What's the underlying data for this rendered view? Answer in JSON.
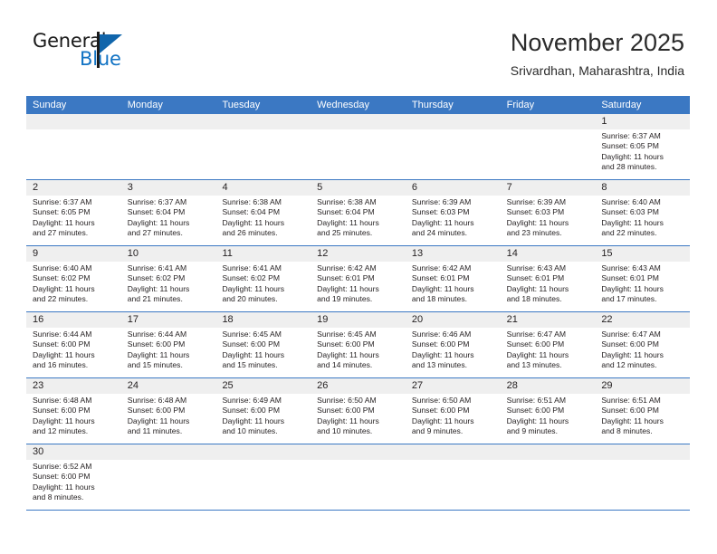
{
  "brand": {
    "name_top": "General",
    "name_bottom": "Blue",
    "accent_color": "#1273c4",
    "mark_color": "#1065ab"
  },
  "header": {
    "title": "November 2025",
    "subtitle": "Srivardhan, Maharashtra, India"
  },
  "calendar": {
    "header_color": "#3b78c3",
    "daynum_band_color": "#efefef",
    "weekdays": [
      "Sunday",
      "Monday",
      "Tuesday",
      "Wednesday",
      "Thursday",
      "Friday",
      "Saturday"
    ],
    "weeks": [
      [
        {
          "day": "",
          "empty": true
        },
        {
          "day": "",
          "empty": true
        },
        {
          "day": "",
          "empty": true
        },
        {
          "day": "",
          "empty": true
        },
        {
          "day": "",
          "empty": true
        },
        {
          "day": "",
          "empty": true
        },
        {
          "day": "1",
          "sunrise": "Sunrise: 6:37 AM",
          "sunset": "Sunset: 6:05 PM",
          "daylight_1": "Daylight: 11 hours",
          "daylight_2": "and 28 minutes."
        }
      ],
      [
        {
          "day": "2",
          "sunrise": "Sunrise: 6:37 AM",
          "sunset": "Sunset: 6:05 PM",
          "daylight_1": "Daylight: 11 hours",
          "daylight_2": "and 27 minutes."
        },
        {
          "day": "3",
          "sunrise": "Sunrise: 6:37 AM",
          "sunset": "Sunset: 6:04 PM",
          "daylight_1": "Daylight: 11 hours",
          "daylight_2": "and 27 minutes."
        },
        {
          "day": "4",
          "sunrise": "Sunrise: 6:38 AM",
          "sunset": "Sunset: 6:04 PM",
          "daylight_1": "Daylight: 11 hours",
          "daylight_2": "and 26 minutes."
        },
        {
          "day": "5",
          "sunrise": "Sunrise: 6:38 AM",
          "sunset": "Sunset: 6:04 PM",
          "daylight_1": "Daylight: 11 hours",
          "daylight_2": "and 25 minutes."
        },
        {
          "day": "6",
          "sunrise": "Sunrise: 6:39 AM",
          "sunset": "Sunset: 6:03 PM",
          "daylight_1": "Daylight: 11 hours",
          "daylight_2": "and 24 minutes."
        },
        {
          "day": "7",
          "sunrise": "Sunrise: 6:39 AM",
          "sunset": "Sunset: 6:03 PM",
          "daylight_1": "Daylight: 11 hours",
          "daylight_2": "and 23 minutes."
        },
        {
          "day": "8",
          "sunrise": "Sunrise: 6:40 AM",
          "sunset": "Sunset: 6:03 PM",
          "daylight_1": "Daylight: 11 hours",
          "daylight_2": "and 22 minutes."
        }
      ],
      [
        {
          "day": "9",
          "sunrise": "Sunrise: 6:40 AM",
          "sunset": "Sunset: 6:02 PM",
          "daylight_1": "Daylight: 11 hours",
          "daylight_2": "and 22 minutes."
        },
        {
          "day": "10",
          "sunrise": "Sunrise: 6:41 AM",
          "sunset": "Sunset: 6:02 PM",
          "daylight_1": "Daylight: 11 hours",
          "daylight_2": "and 21 minutes."
        },
        {
          "day": "11",
          "sunrise": "Sunrise: 6:41 AM",
          "sunset": "Sunset: 6:02 PM",
          "daylight_1": "Daylight: 11 hours",
          "daylight_2": "and 20 minutes."
        },
        {
          "day": "12",
          "sunrise": "Sunrise: 6:42 AM",
          "sunset": "Sunset: 6:01 PM",
          "daylight_1": "Daylight: 11 hours",
          "daylight_2": "and 19 minutes."
        },
        {
          "day": "13",
          "sunrise": "Sunrise: 6:42 AM",
          "sunset": "Sunset: 6:01 PM",
          "daylight_1": "Daylight: 11 hours",
          "daylight_2": "and 18 minutes."
        },
        {
          "day": "14",
          "sunrise": "Sunrise: 6:43 AM",
          "sunset": "Sunset: 6:01 PM",
          "daylight_1": "Daylight: 11 hours",
          "daylight_2": "and 18 minutes."
        },
        {
          "day": "15",
          "sunrise": "Sunrise: 6:43 AM",
          "sunset": "Sunset: 6:01 PM",
          "daylight_1": "Daylight: 11 hours",
          "daylight_2": "and 17 minutes."
        }
      ],
      [
        {
          "day": "16",
          "sunrise": "Sunrise: 6:44 AM",
          "sunset": "Sunset: 6:00 PM",
          "daylight_1": "Daylight: 11 hours",
          "daylight_2": "and 16 minutes."
        },
        {
          "day": "17",
          "sunrise": "Sunrise: 6:44 AM",
          "sunset": "Sunset: 6:00 PM",
          "daylight_1": "Daylight: 11 hours",
          "daylight_2": "and 15 minutes."
        },
        {
          "day": "18",
          "sunrise": "Sunrise: 6:45 AM",
          "sunset": "Sunset: 6:00 PM",
          "daylight_1": "Daylight: 11 hours",
          "daylight_2": "and 15 minutes."
        },
        {
          "day": "19",
          "sunrise": "Sunrise: 6:45 AM",
          "sunset": "Sunset: 6:00 PM",
          "daylight_1": "Daylight: 11 hours",
          "daylight_2": "and 14 minutes."
        },
        {
          "day": "20",
          "sunrise": "Sunrise: 6:46 AM",
          "sunset": "Sunset: 6:00 PM",
          "daylight_1": "Daylight: 11 hours",
          "daylight_2": "and 13 minutes."
        },
        {
          "day": "21",
          "sunrise": "Sunrise: 6:47 AM",
          "sunset": "Sunset: 6:00 PM",
          "daylight_1": "Daylight: 11 hours",
          "daylight_2": "and 13 minutes."
        },
        {
          "day": "22",
          "sunrise": "Sunrise: 6:47 AM",
          "sunset": "Sunset: 6:00 PM",
          "daylight_1": "Daylight: 11 hours",
          "daylight_2": "and 12 minutes."
        }
      ],
      [
        {
          "day": "23",
          "sunrise": "Sunrise: 6:48 AM",
          "sunset": "Sunset: 6:00 PM",
          "daylight_1": "Daylight: 11 hours",
          "daylight_2": "and 12 minutes."
        },
        {
          "day": "24",
          "sunrise": "Sunrise: 6:48 AM",
          "sunset": "Sunset: 6:00 PM",
          "daylight_1": "Daylight: 11 hours",
          "daylight_2": "and 11 minutes."
        },
        {
          "day": "25",
          "sunrise": "Sunrise: 6:49 AM",
          "sunset": "Sunset: 6:00 PM",
          "daylight_1": "Daylight: 11 hours",
          "daylight_2": "and 10 minutes."
        },
        {
          "day": "26",
          "sunrise": "Sunrise: 6:50 AM",
          "sunset": "Sunset: 6:00 PM",
          "daylight_1": "Daylight: 11 hours",
          "daylight_2": "and 10 minutes."
        },
        {
          "day": "27",
          "sunrise": "Sunrise: 6:50 AM",
          "sunset": "Sunset: 6:00 PM",
          "daylight_1": "Daylight: 11 hours",
          "daylight_2": "and 9 minutes."
        },
        {
          "day": "28",
          "sunrise": "Sunrise: 6:51 AM",
          "sunset": "Sunset: 6:00 PM",
          "daylight_1": "Daylight: 11 hours",
          "daylight_2": "and 9 minutes."
        },
        {
          "day": "29",
          "sunrise": "Sunrise: 6:51 AM",
          "sunset": "Sunset: 6:00 PM",
          "daylight_1": "Daylight: 11 hours",
          "daylight_2": "and 8 minutes."
        }
      ],
      [
        {
          "day": "30",
          "sunrise": "Sunrise: 6:52 AM",
          "sunset": "Sunset: 6:00 PM",
          "daylight_1": "Daylight: 11 hours",
          "daylight_2": "and 8 minutes."
        },
        {
          "day": "",
          "empty": true
        },
        {
          "day": "",
          "empty": true
        },
        {
          "day": "",
          "empty": true
        },
        {
          "day": "",
          "empty": true
        },
        {
          "day": "",
          "empty": true
        },
        {
          "day": "",
          "empty": true
        }
      ]
    ]
  }
}
